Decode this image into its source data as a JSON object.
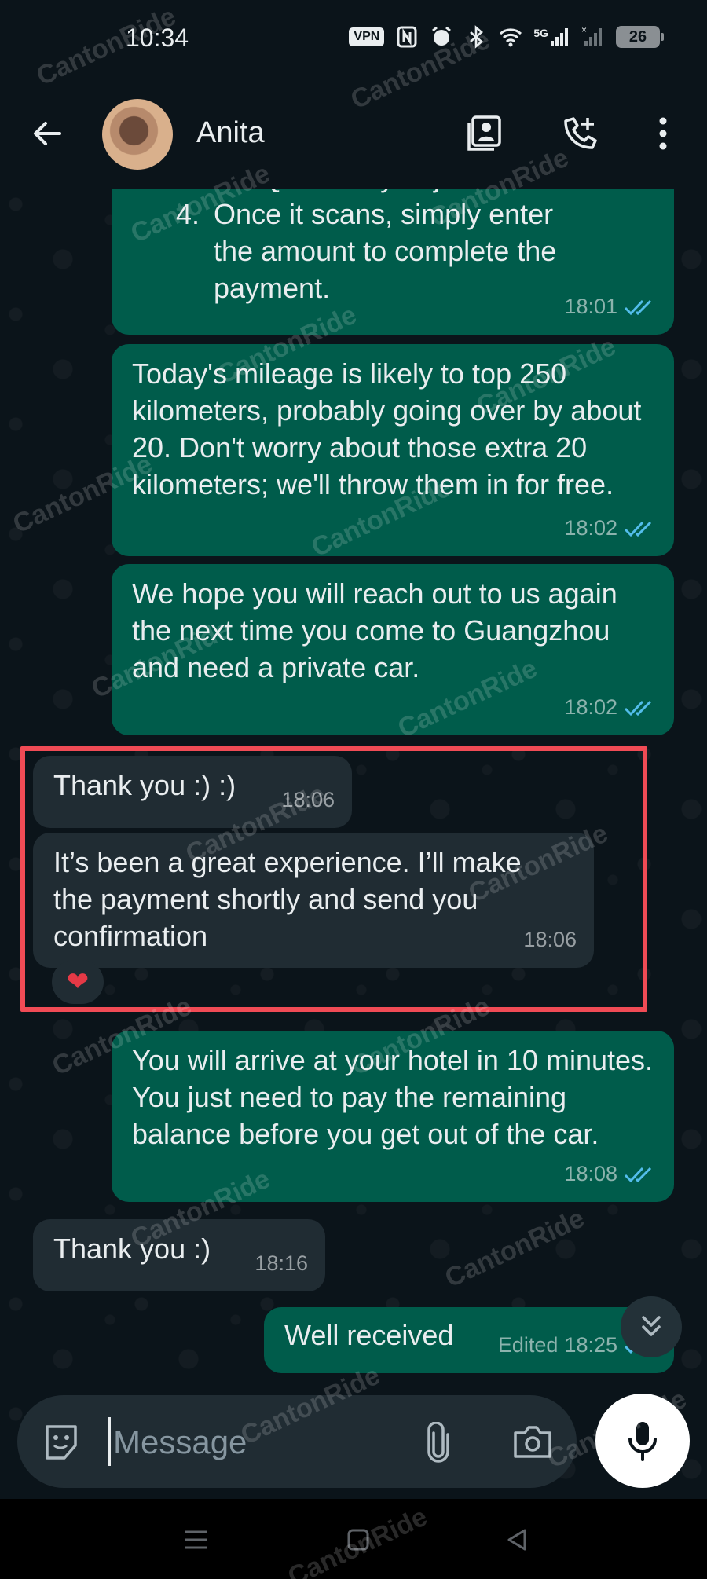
{
  "status_bar": {
    "time": "10:34",
    "vpn_label": "VPN",
    "network_label": "5G",
    "battery_level": "26"
  },
  "header": {
    "contact_name": "Anita"
  },
  "messages": [
    {
      "direction": "out",
      "list_lines": [
        {
          "num": "",
          "text": "the QR code you just saved."
        },
        {
          "num": "4.",
          "text": "Once it scans, simply enter"
        },
        {
          "num": "",
          "text": "the amount to complete the"
        },
        {
          "num": "",
          "text": "payment."
        }
      ],
      "time": "18:01",
      "status": "read"
    },
    {
      "direction": "out",
      "text": "Today's mileage is likely to top 250 kilometers, probably going over by about 20. Don't worry about those extra 20 kilometers; we'll throw them in for free.",
      "time": "18:02",
      "status": "read"
    },
    {
      "direction": "out",
      "text": "We hope you will reach out to us again the next time you come to Guangzhou and need a private car.",
      "time": "18:02",
      "status": "read"
    },
    {
      "direction": "in",
      "text": "Thank you :) :)",
      "time": "18:06"
    },
    {
      "direction": "in",
      "text": "It’s been a great experience. I’ll make the payment shortly and send you confirmation",
      "time": "18:06",
      "reaction": "❤"
    },
    {
      "direction": "out",
      "text": "You will arrive at your hotel in 10 minutes. You just need to pay the remaining balance before you get out of the car.",
      "time": "18:08",
      "status": "read"
    },
    {
      "direction": "in",
      "text": "Thank you :)",
      "time": "18:16"
    },
    {
      "direction": "out",
      "text": "Well received",
      "edited_label": "Edited",
      "time": "18:25",
      "status": "read"
    }
  ],
  "composer": {
    "placeholder": "Message"
  },
  "watermark": "CantonRide",
  "colors": {
    "outgoing_bubble": "#005c4b",
    "incoming_bubble": "#202c33",
    "read_ticks": "#53bdeb",
    "highlight": "#f04b55",
    "background": "#0b141a"
  }
}
